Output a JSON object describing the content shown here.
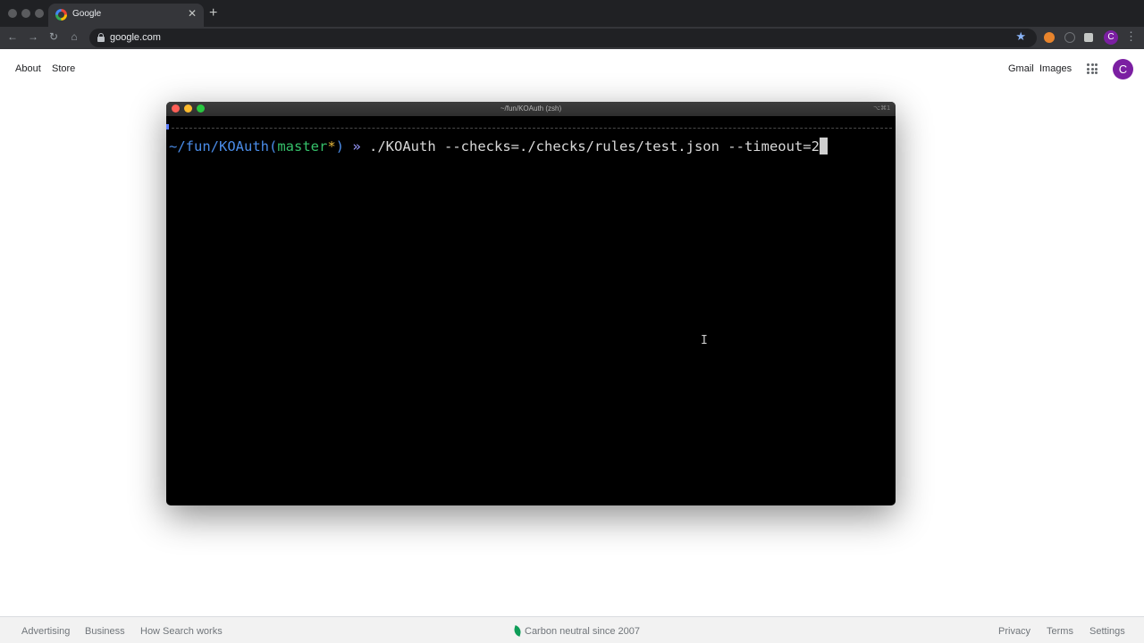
{
  "browser": {
    "tab_title": "Google",
    "tab_close": "✕",
    "new_tab": "+",
    "url": "google.com",
    "back_icon": "←",
    "forward_icon": "→",
    "reload_icon": "↻",
    "home_icon": "⌂",
    "bookmark_icon": "★",
    "profile_initial": "C",
    "menu_icon": "⋮"
  },
  "google": {
    "top_left_links": [
      "About",
      "Store"
    ],
    "top_right_links": [
      "Gmail",
      "Images"
    ],
    "avatar_initial": "C",
    "footer_left": [
      "Advertising",
      "Business",
      "How Search works"
    ],
    "footer_center": "Carbon neutral since 2007",
    "footer_right": [
      "Privacy",
      "Terms",
      "Settings"
    ]
  },
  "terminal": {
    "title": "~/fun/KOAuth (zsh)",
    "shortcut": "⌥⌘1",
    "prompt_path": "~/fun/KOAuth",
    "prompt_open": "(",
    "branch": "master",
    "dirty_mark": "*",
    "prompt_close": ")",
    "prompt_arrow": " » ",
    "command": "./KOAuth --checks=./checks/rules/test.json --timeout=2"
  },
  "colors": {
    "terminal_bg": "#000000",
    "path": "#4a8ce8",
    "branch": "#35c06a",
    "dirty": "#e7b83c",
    "avatar": "#7b1fa2"
  }
}
